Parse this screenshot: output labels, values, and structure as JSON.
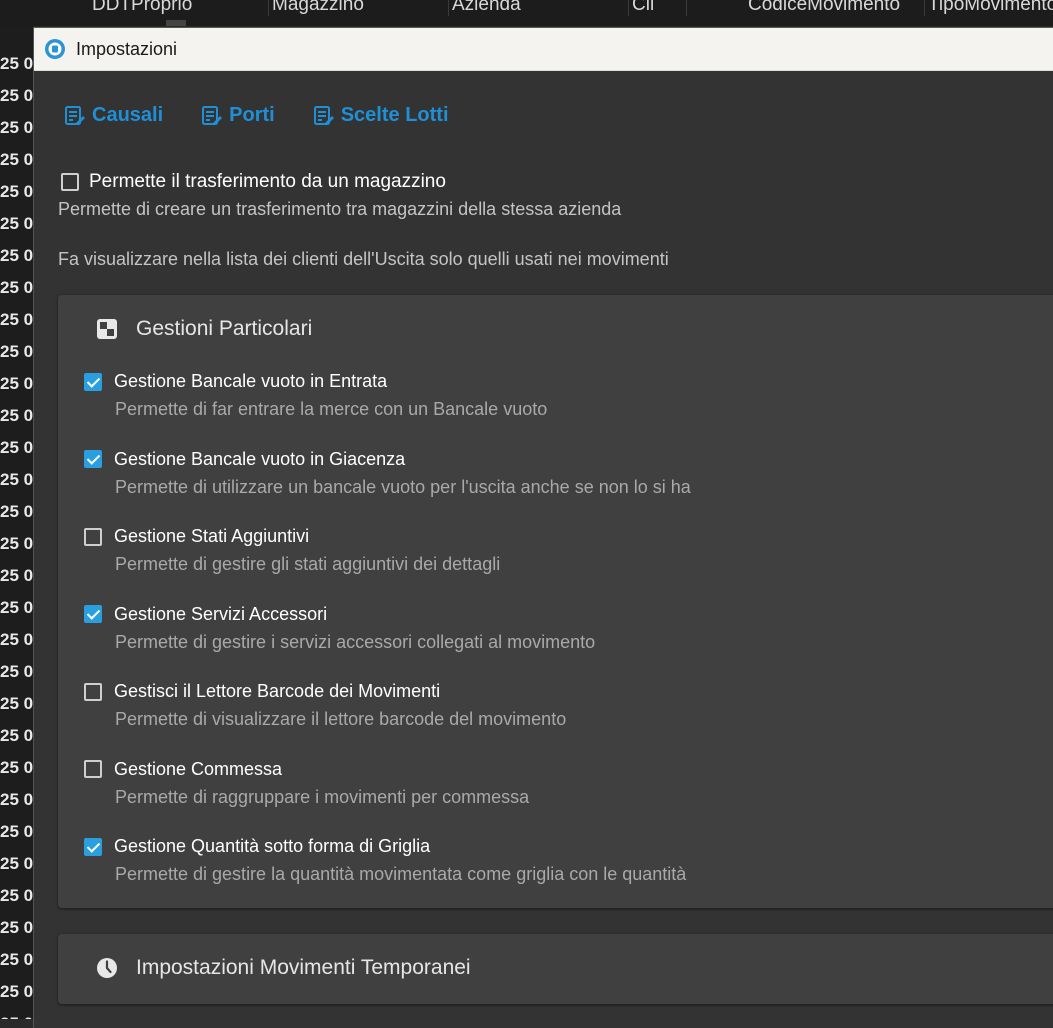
{
  "background": {
    "columns": [
      "DDTProprio",
      "Magazzino",
      "Azienda",
      "Cli",
      "CodiceMovimento",
      "TipoMovimento"
    ],
    "row_text": "25 0"
  },
  "dialog": {
    "title": "Impostazioni",
    "links": [
      "Causali",
      "Porti",
      "Scelte Lotti"
    ],
    "transfer": {
      "label": "Permette il trasferimento da un magazzino",
      "checked": false,
      "description": "Permette di creare un trasferimento tra magazzini della stessa azienda"
    },
    "clients_note": "Fa visualizzare nella lista dei clienti dell'Uscita solo quelli usati nei movimenti",
    "panel": {
      "title": "Gestioni Particolari",
      "icon": "particolari-icon",
      "options": [
        {
          "label": "Gestione Bancale vuoto in Entrata",
          "description": "Permette di far entrare la merce con un Bancale vuoto",
          "checked": true
        },
        {
          "label": "Gestione Bancale vuoto in Giacenza",
          "description": "Permette di utilizzare un bancale vuoto per l'uscita anche se non lo si ha",
          "checked": true
        },
        {
          "label": "Gestione Stati Aggiuntivi",
          "description": "Permette di gestire gli stati aggiuntivi dei dettagli",
          "checked": false
        },
        {
          "label": "Gestione Servizi Accessori",
          "description": "Permette di gestire i servizi accessori collegati al movimento",
          "checked": true
        },
        {
          "label": "Gestisci il Lettore Barcode dei Movimenti",
          "description": "Permette di visualizzare il lettore barcode del movimento",
          "checked": false
        },
        {
          "label": "Gestione Commessa",
          "description": "Permette di raggruppare i movimenti per commessa",
          "checked": false
        },
        {
          "label": "Gestione Quantità sotto forma di Griglia",
          "description": "Permette di gestire la quantità movimentata come griglia con le quantità",
          "checked": true
        }
      ]
    },
    "panel2": {
      "title": "Impostazioni Movimenti Temporanei",
      "icon": "clock-icon"
    }
  },
  "colors": {
    "accent": "#2a9fe0",
    "link": "#1f8fd6",
    "dialog_bg": "#333333",
    "panel_bg": "#404040"
  }
}
